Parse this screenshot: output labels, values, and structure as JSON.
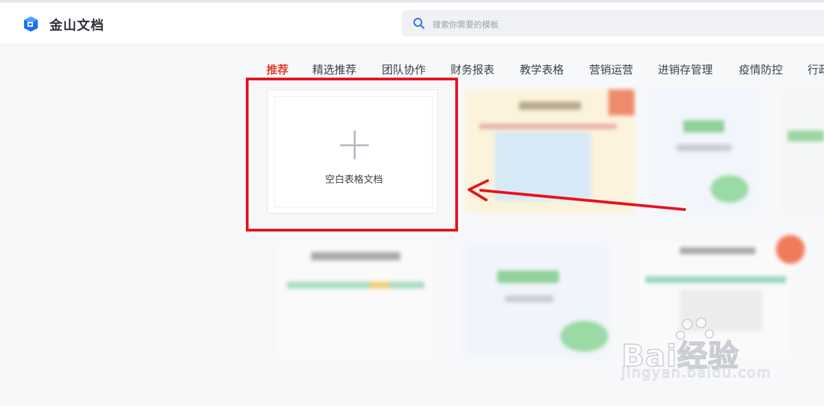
{
  "header": {
    "brand": "金山文档",
    "search_placeholder": "搜索你需要的模板"
  },
  "tabs": [
    {
      "label": "推荐",
      "active": true
    },
    {
      "label": "精选推荐",
      "active": false
    },
    {
      "label": "团队协作",
      "active": false
    },
    {
      "label": "财务报表",
      "active": false
    },
    {
      "label": "教学表格",
      "active": false
    },
    {
      "label": "营销运营",
      "active": false
    },
    {
      "label": "进销存管理",
      "active": false
    },
    {
      "label": "疫情防控",
      "active": false
    },
    {
      "label": "行政",
      "active": false
    }
  ],
  "blank_card": {
    "label": "空白表格文档"
  },
  "annotation": {
    "color": "#e8121f"
  },
  "watermark": {
    "main": "Bai经验",
    "url": "jingyan.baidu.com"
  },
  "colors": {
    "accent_active_tab": "#e2412c",
    "logo_blue": "#1e6ff0"
  }
}
